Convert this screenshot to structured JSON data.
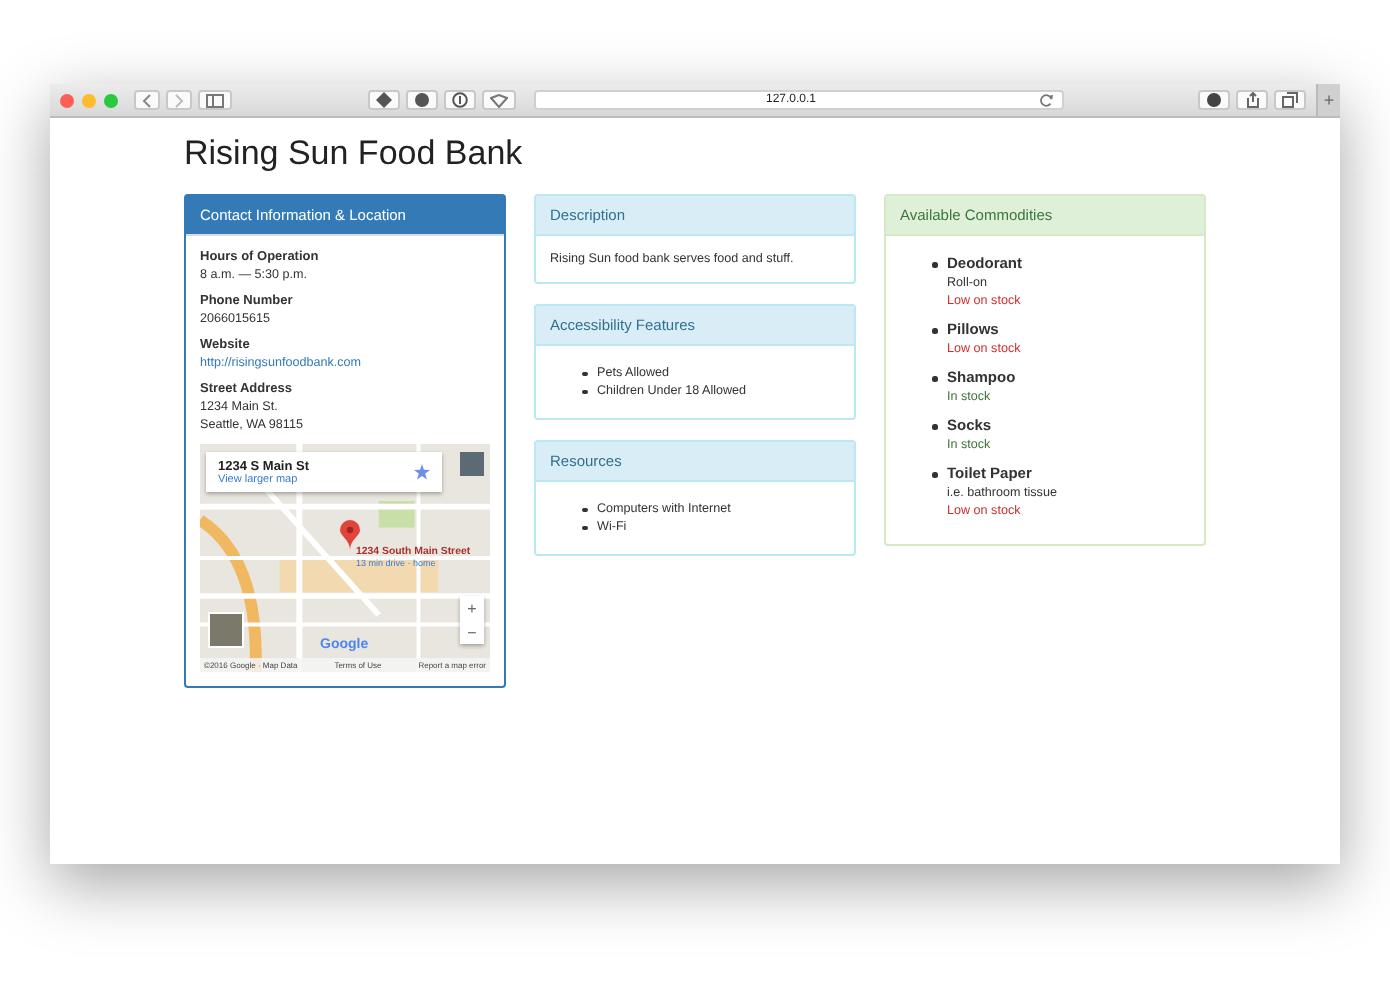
{
  "browser": {
    "url": "127.0.0.1",
    "new_tab": "+"
  },
  "page_title": "Rising Sun Food Bank",
  "contact": {
    "heading": "Contact Information & Location",
    "fields": [
      {
        "label": "Hours of Operation",
        "lines": [
          "8 a.m. — 5:30 p.m."
        ],
        "kind": "text"
      },
      {
        "label": "Phone Number",
        "lines": [
          "2066015615"
        ],
        "kind": "text"
      },
      {
        "label": "Website",
        "lines": [
          "http://risingsunfoodbank.com"
        ],
        "kind": "link"
      },
      {
        "label": "Street Address",
        "lines": [
          "1234 Main St.",
          "Seattle, WA 98115"
        ],
        "kind": "text"
      }
    ],
    "map": {
      "place": "1234 S Main St",
      "larger_link": "View larger map",
      "pin_label": "1234 South Main Street",
      "pin_sub": "13 min drive · home",
      "zoom_in": "+",
      "zoom_out": "−",
      "logo": "Google",
      "footer": [
        "©2016 Google · Map Data",
        "Terms of Use",
        "Report a map error"
      ]
    }
  },
  "description": {
    "heading": "Description",
    "text": "Rising Sun food bank serves food and stuff."
  },
  "accessibility": {
    "heading": "Accessibility Features",
    "items": [
      "Pets Allowed",
      "Children Under 18 Allowed"
    ]
  },
  "resources": {
    "heading": "Resources",
    "items": [
      "Computers with Internet",
      "Wi-Fi"
    ]
  },
  "commodities": {
    "heading": "Available Commodities",
    "items": [
      {
        "name": "Deodorant",
        "note": "Roll-on",
        "status": "Low on stock",
        "in_stock": false
      },
      {
        "name": "Pillows",
        "status": "Low on stock",
        "in_stock": false
      },
      {
        "name": "Shampoo",
        "status": "In stock",
        "in_stock": true
      },
      {
        "name": "Socks",
        "status": "In stock",
        "in_stock": true
      },
      {
        "name": "Toilet Paper",
        "note": "i.e. bathroom tissue",
        "status": "Low on stock",
        "in_stock": false
      }
    ]
  }
}
